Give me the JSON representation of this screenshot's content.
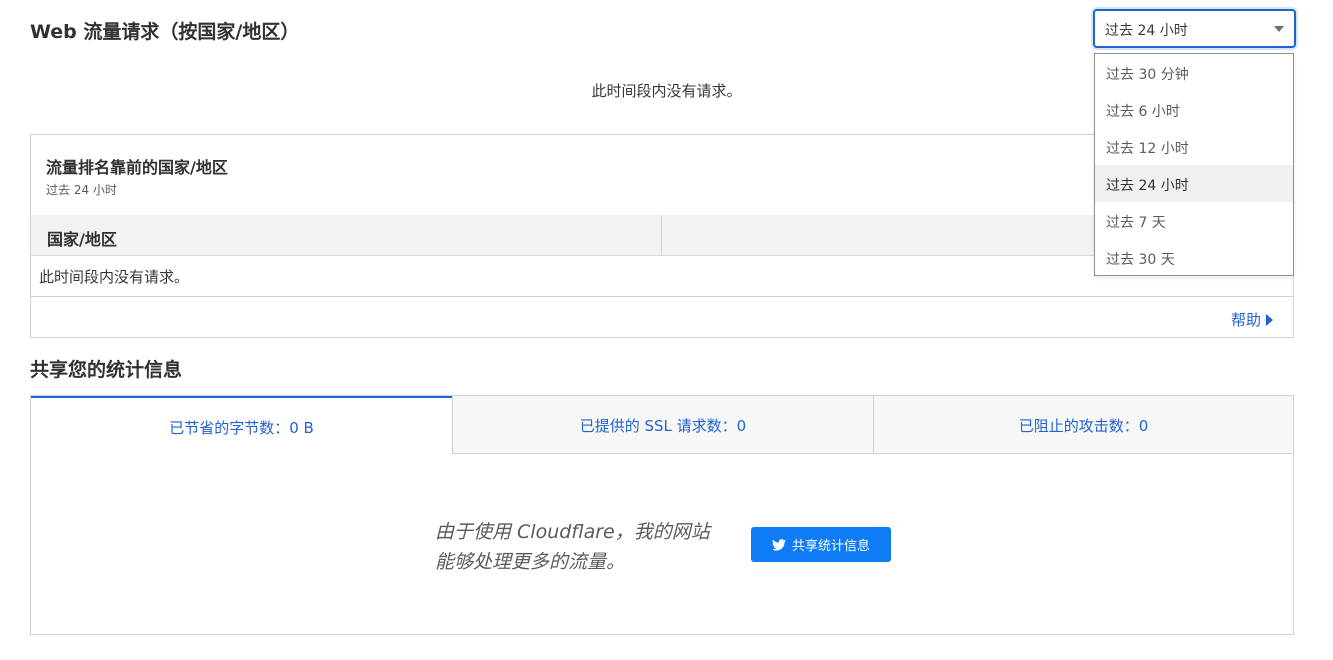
{
  "web_traffic": {
    "title": "Web 流量请求（按国家/地区）",
    "range_value": "过去 24 小时",
    "no_requests": "此时间段内没有请求。"
  },
  "top_countries": {
    "title": "流量排名靠前的国家/地区",
    "subtitle": "过去 24 小时",
    "column_country": "国家/地区",
    "empty_text": "此时间段内没有请求。",
    "help_label": "帮助"
  },
  "share_stats": {
    "title": "共享您的统计信息",
    "tabs": [
      {
        "label": "已节省的字节数：0 B",
        "active": true
      },
      {
        "label": "已提供的 SSL 请求数：0",
        "active": false
      },
      {
        "label": "已阻止的攻击数：0",
        "active": false
      }
    ],
    "message_line1": "由于使用 Cloudflare，我的网站",
    "message_line2": "能够处理更多的流量。",
    "share_button_label": "共享统计信息",
    "share_icon": "twitter-icon"
  },
  "range_dropdown": {
    "options": [
      "过去 30 分钟",
      "过去 6 小时",
      "过去 12 小时",
      "过去 24 小时",
      "过去 7 天",
      "过去 30 天"
    ],
    "selected": "过去 24 小时"
  },
  "colors": {
    "accent": "#1f62d1",
    "button": "#0f7cf5",
    "border": "#cfd2d3"
  }
}
